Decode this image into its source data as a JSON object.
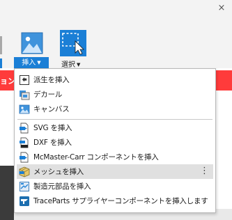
{
  "window": {
    "close_glyph": "×"
  },
  "ribbon": {
    "insert_label": "挿入",
    "select_label": "選択",
    "caret_glyph": "▼"
  },
  "banner": {
    "text": "ョン",
    "color": "#ff3b3b"
  },
  "menu": {
    "more_glyph": "⋮",
    "items": [
      {
        "label": "派生を挿入",
        "icon": "derived-part-icon"
      },
      {
        "label": "デカール",
        "icon": "decal-icon"
      },
      {
        "label": "キャンバス",
        "icon": "canvas-icon"
      },
      {
        "label": "SVG を挿入",
        "icon": "svg-file-icon"
      },
      {
        "label": "DXF を挿入",
        "icon": "dxf-file-icon"
      },
      {
        "label": "McMaster-Carr コンポーネントを挿入",
        "icon": "mcmaster-icon"
      },
      {
        "label": "メッシュを挿入",
        "icon": "mesh-icon",
        "highlighted": true
      },
      {
        "label": "製造元部品を挿入",
        "icon": "manufacturer-part-icon"
      },
      {
        "label": "TraceParts サプライヤーコンポーネントを挿入します",
        "icon": "traceparts-icon"
      }
    ]
  },
  "colors": {
    "accent": "#1b7fd6",
    "highlight": "#e0e0e0"
  }
}
